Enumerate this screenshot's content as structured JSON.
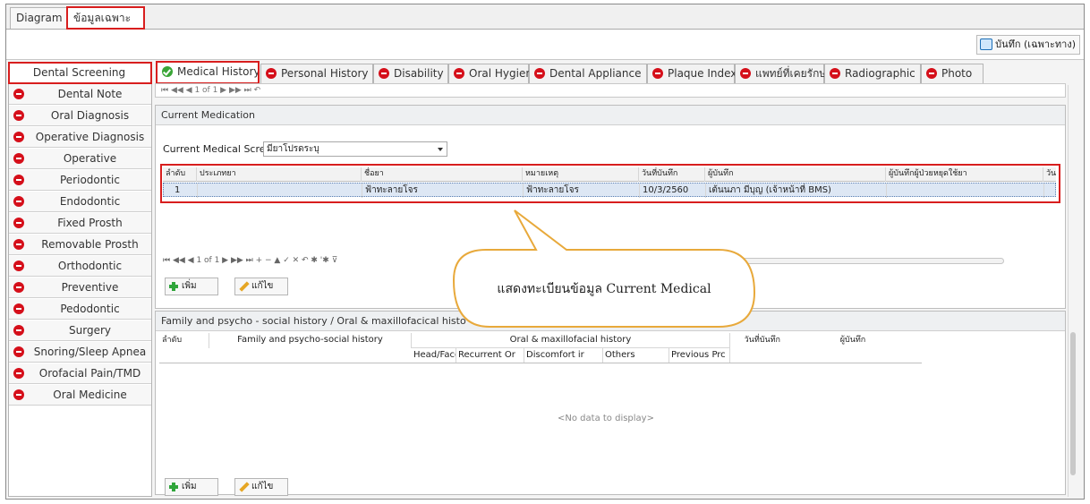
{
  "top_tabs": [
    "Diagram",
    "ข้อมูลเฉพาะทาง"
  ],
  "toolbar": {
    "save_label": "บันทึก (เฉพาะทาง)"
  },
  "sidebar": {
    "items": [
      {
        "label": "Dental Screening",
        "icon": "none"
      },
      {
        "label": "Dental Note",
        "icon": "minus-icon"
      },
      {
        "label": "Oral Diagnosis",
        "icon": "minus-icon"
      },
      {
        "label": "Operative Diagnosis",
        "icon": "minus-icon"
      },
      {
        "label": "Operative",
        "icon": "minus-icon"
      },
      {
        "label": "Periodontic",
        "icon": "minus-icon"
      },
      {
        "label": "Endodontic",
        "icon": "minus-icon"
      },
      {
        "label": "Fixed Prosth",
        "icon": "minus-icon"
      },
      {
        "label": "Removable Prosth",
        "icon": "minus-icon"
      },
      {
        "label": "Orthodontic",
        "icon": "minus-icon"
      },
      {
        "label": "Preventive",
        "icon": "minus-icon"
      },
      {
        "label": "Pedodontic",
        "icon": "minus-icon"
      },
      {
        "label": "Surgery",
        "icon": "minus-icon"
      },
      {
        "label": "Snoring/Sleep Apnea",
        "icon": "minus-icon"
      },
      {
        "label": "Orofacial Pain/TMD",
        "icon": "minus-icon"
      },
      {
        "label": "Oral Medicine",
        "icon": "minus-icon"
      }
    ]
  },
  "sub_tabs": [
    {
      "label": "Medical History",
      "icon": "check-icon"
    },
    {
      "label": "Personal History",
      "icon": "minus-icon"
    },
    {
      "label": "Disability",
      "icon": "minus-icon"
    },
    {
      "label": "Oral Hygiene",
      "icon": "minus-icon"
    },
    {
      "label": "Dental Appliance",
      "icon": "minus-icon"
    },
    {
      "label": "Plaque Index",
      "icon": "minus-icon"
    },
    {
      "label": "แพทย์ที่เคยรักษา",
      "icon": "minus-icon"
    },
    {
      "label": "Radiographic",
      "icon": "minus-icon"
    },
    {
      "label": "Photo",
      "icon": "minus-icon"
    }
  ],
  "nav_strip": "⏮ ◀◀ ◀ 1 of 1 ▶ ▶▶ ⏭ ↶",
  "current_medication": {
    "title": "Current Medication",
    "screen_label": "Current Medical Screen",
    "screen_value": "มียาโปรดระบุ",
    "columns": [
      "ลำดับ",
      "ประเภทยา",
      "ชื่อยา",
      "หมายเหตุ",
      "วันที่บันทึก",
      "ผู้บันทึก",
      "ผู้บันทึกผู้ป่วยหยุดใช้ยา",
      "วัน"
    ],
    "rows": [
      [
        "1",
        "",
        "ฟ้าทะลายโจร",
        "ฟ้าทะลายโจร",
        "10/3/2560",
        "เต้นนภา มีบุญ (เจ้าหน้าที่ BMS)",
        "",
        ""
      ]
    ],
    "pager": "⏮ ◀◀ ◀ 1 of 1 ▶ ▶▶ ⏭ + − ▲ ✓ ✕ ↶ ✱ '✱ ⊽",
    "add_label": "เพิ่ม",
    "edit_label": "แก้ไข"
  },
  "callout": {
    "text": "แสดงทะเบียนข้อมูล Current Medical"
  },
  "family": {
    "title": "Family and psycho - social history / Oral & maxillofacical histo",
    "col_no": "ลำดับ",
    "col_family": "Family and psycho-social history",
    "col_oral": "Oral & maxillofacial history",
    "col_date": "วันที่บันทึก",
    "col_recorder": "ผู้บันทึก",
    "sub_cols": [
      "Head/Face/",
      "Recurrent Or",
      "Discomfort ir",
      "Others",
      "Previous Prc"
    ],
    "empty_text": "<No data to display>",
    "add_label": "เพิ่ม",
    "edit_label": "แก้ไข"
  },
  "colors": {
    "highlight_red": "#d81e1e",
    "selected_row": "#dde7f4",
    "minus_red": "#d50f1a",
    "check_green": "#3aa637"
  }
}
